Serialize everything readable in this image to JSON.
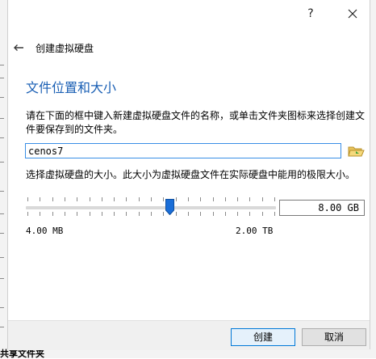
{
  "titlebar": {
    "help_label": "?"
  },
  "wizard": {
    "title": "创建虚拟硬盘",
    "section_heading": "文件位置和大小",
    "location_description": "请在下面的框中键入新建虚拟硬盘文件的名称，或单击文件夹图标来选择创建文件要保存到的文件夹。",
    "file_name": "cenos7",
    "size_description": "选择虚拟硬盘的大小。此大小为虚拟硬盘文件在实际硬盘中能用的极限大小。",
    "size_value": "8.00 GB",
    "size_slider_fraction": 0.58,
    "range_min": "4.00 MB",
    "range_max": "2.00 TB"
  },
  "buttons": {
    "create": "创建",
    "cancel": "取消"
  },
  "background": {
    "bottom_text": "共享文件夹"
  },
  "colors": {
    "heading": "#1a5fb4",
    "focus_border": "#0078d7",
    "slider_handle": "#1a6ed8"
  },
  "icons": {
    "back": "arrow-left-icon",
    "folder": "folder-open-icon",
    "close": "close-icon"
  }
}
